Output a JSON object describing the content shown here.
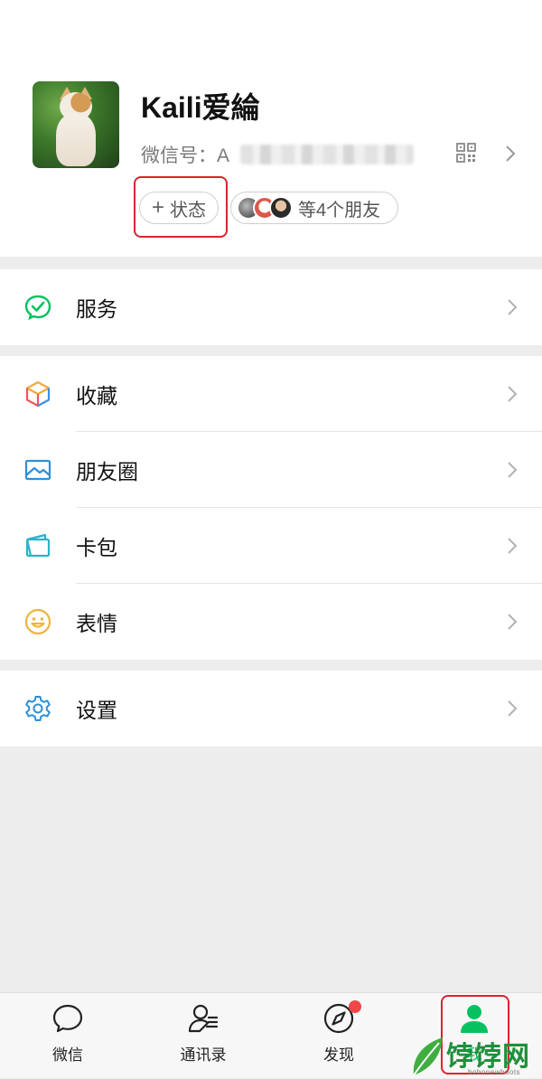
{
  "profile": {
    "name": "Kaili爱綸",
    "wechat_id_label": "微信号：",
    "wechat_id_value": "A",
    "status_plus": "+",
    "status_label": "状态",
    "friends_label": "等4个朋友"
  },
  "menu": {
    "services": "服务",
    "favorites": "收藏",
    "moments": "朋友圈",
    "cards": "卡包",
    "stickers": "表情",
    "settings": "设置"
  },
  "tabbar": {
    "chats": "微信",
    "contacts": "通讯录",
    "discover": "发现",
    "me": "我"
  },
  "watermark": {
    "logo_text": "饽饽网",
    "sub_text": "bobonewboots"
  },
  "colors": {
    "accent_green": "#07c160",
    "annotation_red": "#d9252f",
    "badge_red": "#f04848",
    "background_gray": "#ededed"
  },
  "icons": {
    "qr": "qr-code-icon",
    "chevron": "chevron-right-icon",
    "services": "service-check-icon",
    "favorites": "cube-icon",
    "moments": "picture-icon",
    "cards": "wallet-icon",
    "stickers": "smiley-icon",
    "settings": "gear-icon",
    "chats": "chat-bubble-icon",
    "contacts": "contacts-icon",
    "discover": "compass-icon",
    "me": "person-icon"
  }
}
